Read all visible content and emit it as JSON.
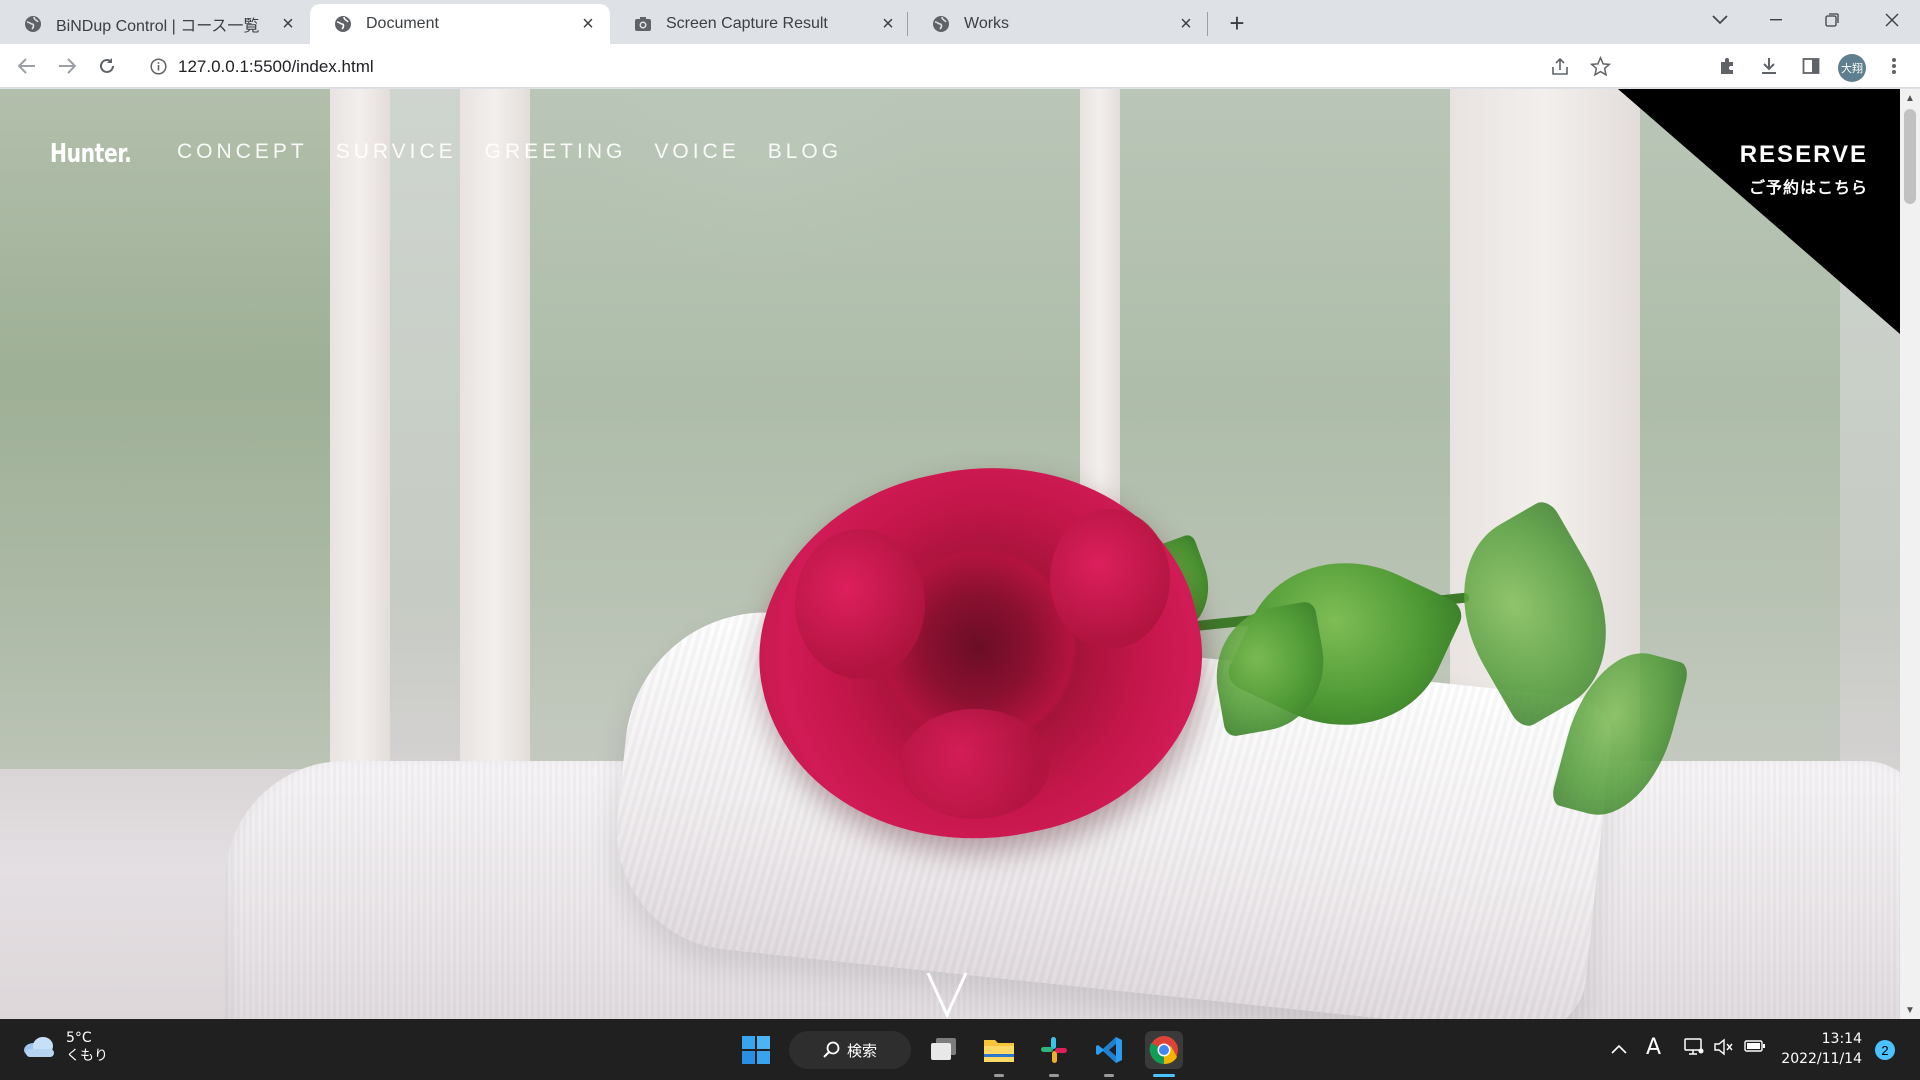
{
  "browser": {
    "tabs": [
      {
        "title": "BiNDup Control | コース一覧",
        "favicon": "globe-icon",
        "active": false
      },
      {
        "title": "Document",
        "favicon": "globe-icon",
        "active": true
      },
      {
        "title": "Screen Capture Result",
        "favicon": "camera-icon",
        "active": false
      },
      {
        "title": "Works",
        "favicon": "globe-icon",
        "active": false
      }
    ],
    "url": "127.0.0.1:5500/index.html",
    "profile_initials": "大翔"
  },
  "site": {
    "logo": "Hunter.",
    "nav": [
      {
        "label": "CONCEPT"
      },
      {
        "label": "SURVICE"
      },
      {
        "label": "GREETING"
      },
      {
        "label": "VOICE"
      },
      {
        "label": "BLOG"
      }
    ],
    "reserve": {
      "title": "RESERVE",
      "subtitle": "ご予約はこちら"
    }
  },
  "taskbar": {
    "weather": {
      "temp": "5°C",
      "condition": "くもり"
    },
    "search_label": "検索",
    "clock": {
      "time": "13:14",
      "date": "2022/11/14"
    },
    "ime_indicator": "A",
    "notification_count": "2"
  },
  "colors": {
    "tab_strip": "#dee1e6",
    "reserve_bg": "#000000",
    "rose": "#c4164a",
    "taskbar": "#202020",
    "notification_badge": "#4cc2ff"
  }
}
